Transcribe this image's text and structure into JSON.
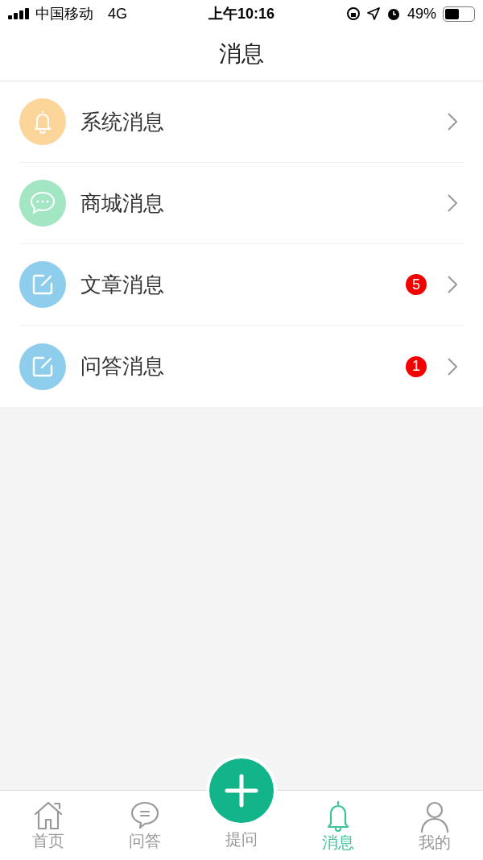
{
  "status_bar": {
    "carrier": "中国移动",
    "network": "4G",
    "time": "上午10:16",
    "battery": "49%"
  },
  "header": {
    "title": "消息"
  },
  "items": [
    {
      "label": "系统消息",
      "kind": "bell",
      "color": "#fcd59a"
    },
    {
      "label": "商城消息",
      "kind": "chat",
      "color": "#a3e6c3"
    },
    {
      "label": "文章消息",
      "kind": "edit",
      "color": "#8fcdec",
      "badge": "5"
    },
    {
      "label": "问答消息",
      "kind": "edit",
      "color": "#8fcdec",
      "badge": "1"
    }
  ],
  "tab_bar": [
    {
      "label": "首页",
      "kind": "home",
      "selected": false
    },
    {
      "label": "问答",
      "kind": "chat",
      "selected": false
    },
    {
      "label": "提问",
      "kind": "add",
      "selected": false
    },
    {
      "label": "消息",
      "kind": "bell",
      "selected": true
    },
    {
      "label": "我的",
      "kind": "user",
      "selected": false
    }
  ]
}
